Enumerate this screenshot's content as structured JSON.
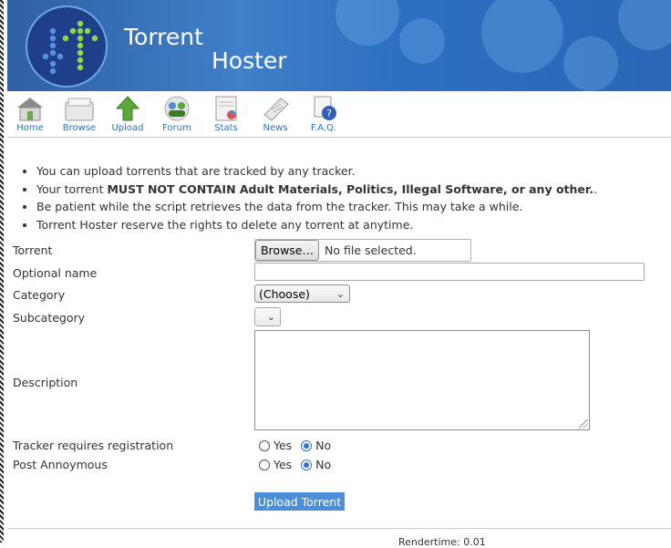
{
  "header": {
    "title_line1": "Torrent",
    "title_line2": "Hoster"
  },
  "nav": {
    "items": [
      {
        "label": "Home",
        "icon": "home-icon"
      },
      {
        "label": "Browse",
        "icon": "browse-icon"
      },
      {
        "label": "Upload",
        "icon": "upload-icon"
      },
      {
        "label": "Forum",
        "icon": "forum-icon"
      },
      {
        "label": "Stats",
        "icon": "stats-icon"
      },
      {
        "label": "News",
        "icon": "news-icon"
      },
      {
        "label": "F.A.Q.",
        "icon": "faq-icon"
      }
    ]
  },
  "notes": {
    "n1": "You can upload torrents that are tracked by any tracker.",
    "n2_prefix": "Your torrent ",
    "n2_bold": "MUST NOT CONTAIN Adult Materials, Politics, Illegal Software, or any other.",
    "n2_suffix": ".",
    "n3": "Be patient while the script retrieves the data from the tracker. This may take a while.",
    "n4": "Torrent Hoster reserve the rights to delete any torrent at anytime."
  },
  "form": {
    "torrent_label": "Torrent",
    "browse_label": "Browse…",
    "file_status": "No file selected.",
    "optional_name_label": "Optional name",
    "optional_name_value": "",
    "category_label": "Category",
    "category_selected": "(Choose)",
    "subcategory_label": "Subcategory",
    "description_label": "Description",
    "tracker_reg_label": "Tracker requires registration",
    "post_anon_label": "Post Annoymous",
    "yes_label": "Yes",
    "no_label": "No",
    "tracker_reg_value": "No",
    "post_anon_value": "No",
    "submit_label": "Upload Torrent"
  },
  "footer": {
    "rendertime": "Rendertime: 0.01"
  },
  "colors": {
    "banner": "#2f6fc0",
    "nav_link": "#2f6fb8",
    "radio_selected": "#2f6fd8",
    "submit_bg": "#4a90d9"
  }
}
